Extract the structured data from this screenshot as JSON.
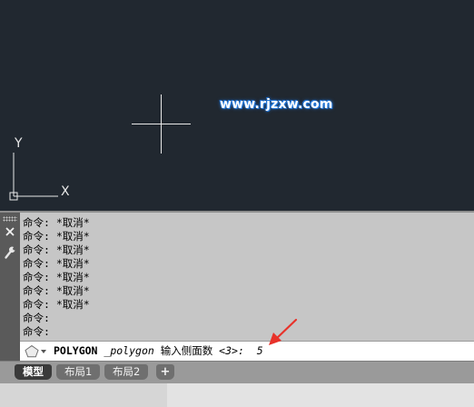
{
  "drawing": {
    "watermark": "www.rjzxw.com",
    "ucs_y_label": "Y",
    "ucs_x_label": "X",
    "background_color": "#212830"
  },
  "command_window": {
    "history": [
      "命令: *取消*",
      "命令: *取消*",
      "命令: *取消*",
      "命令: *取消*",
      "命令: *取消*",
      "命令: *取消*",
      "命令: *取消*",
      "命令:",
      "命令:"
    ],
    "prompt": {
      "icon": "polygon-icon",
      "command": "POLYGON",
      "subcommand": "_polygon",
      "message": "输入侧面数",
      "default": "<3>:",
      "value": "5"
    },
    "sidebar_icons": [
      "close-icon",
      "wrench-icon"
    ]
  },
  "annotation": {
    "arrow_color": "#e8322a"
  },
  "tabs": [
    {
      "label": "模型",
      "active": true
    },
    {
      "label": "布局1",
      "active": false
    },
    {
      "label": "布局2",
      "active": false
    },
    {
      "label": "+",
      "active": false
    }
  ]
}
